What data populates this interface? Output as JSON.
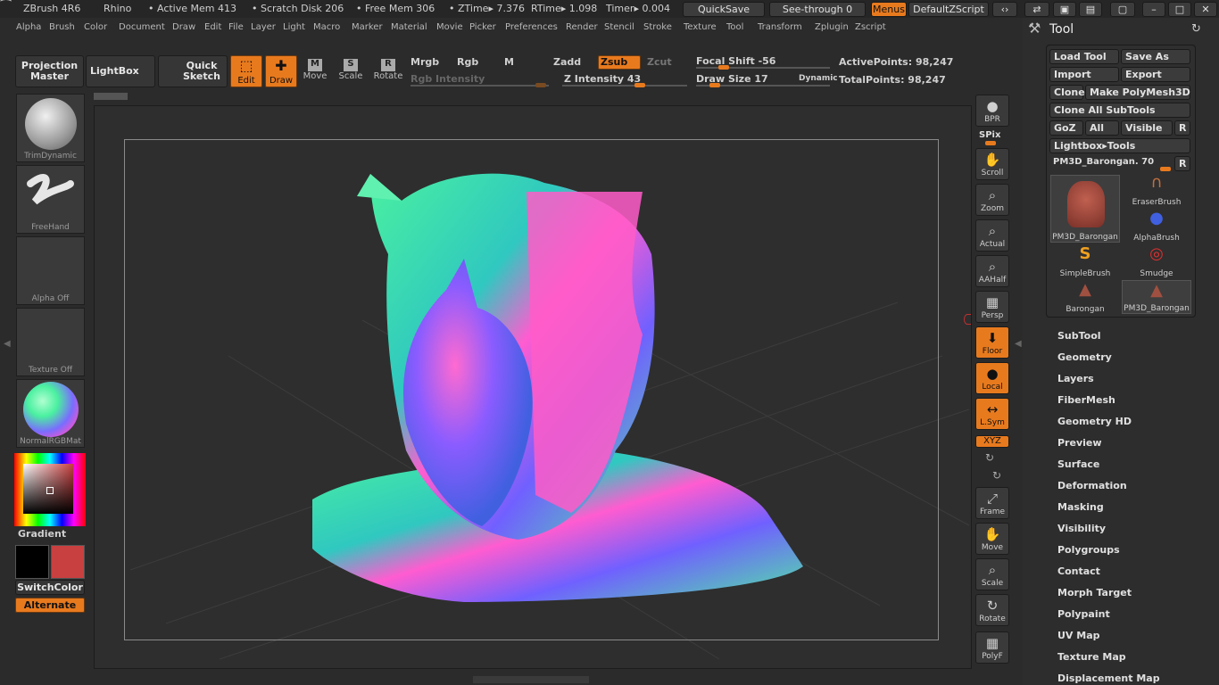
{
  "title_bar": {
    "app": "ZBrush 4R6",
    "doc": "Rhino",
    "active_mem": "• Active Mem 413",
    "scratch": "• Scratch Disk 206",
    "free_mem": "• Free Mem 306",
    "ztime": "• ZTime▸ 7.376",
    "rtime": "RTime▸ 1.098",
    "timer": "Timer▸ 0.004",
    "quicksave": "QuickSave",
    "seethrough": "See-through  0",
    "menus": "Menus",
    "script": "DefaultZScript"
  },
  "menu_items": [
    "Alpha",
    "Brush",
    "Color",
    "Document",
    "Draw",
    "Edit",
    "File",
    "Layer",
    "Light",
    "Macro",
    "Marker",
    "Material",
    "Movie",
    "Picker",
    "Preferences",
    "Render",
    "Stencil",
    "Stroke",
    "Texture",
    "Tool",
    "Transform",
    "Zplugin",
    "Zscript"
  ],
  "toolbar": {
    "projection": "Projection Master",
    "lightbox": "LightBox",
    "quick_sketch": "Quick Sketch",
    "edit": "Edit",
    "draw": "Draw",
    "move": "Move",
    "scale": "Scale",
    "rotate": "Rotate",
    "mrgb": "Mrgb",
    "rgb": "Rgb",
    "m": "M",
    "zadd": "Zadd",
    "zsub": "Zsub",
    "zcut": "Zcut",
    "rgb_intensity": "Rgb Intensity",
    "z_intensity": "Z Intensity 43",
    "focal_shift": "Focal Shift -56",
    "draw_size": "Draw Size 17",
    "dynamic": "Dynamic",
    "active_points": "ActivePoints: 98,247",
    "total_points": "TotalPoints: 98,247"
  },
  "left_shelf": {
    "brush": "TrimDynamic",
    "stroke": "FreeHand",
    "alpha": "Alpha Off",
    "texture": "Texture Off",
    "material": "NormalRGBMat",
    "gradient": "Gradient",
    "switch": "SwitchColor",
    "alternate": "Alternate"
  },
  "right_shelf": [
    {
      "label": "BPR"
    },
    {
      "label": "SPix"
    },
    {
      "label": "Scroll"
    },
    {
      "label": "Zoom"
    },
    {
      "label": "Actual"
    },
    {
      "label": "AAHalf"
    },
    {
      "label": "Persp"
    },
    {
      "label": "Floor"
    },
    {
      "label": "Local"
    },
    {
      "label": "L.Sym"
    },
    {
      "label": "XYZ"
    },
    {
      "label": "Frame"
    },
    {
      "label": "Move"
    },
    {
      "label": "Scale"
    },
    {
      "label": "Rotate"
    },
    {
      "label": "PolyF"
    }
  ],
  "tool_panel": {
    "title": "Tool",
    "load": "Load Tool",
    "save": "Save As",
    "import": "Import",
    "export": "Export",
    "clone": "Clone",
    "make": "Make PolyMesh3D",
    "clone_all": "Clone  All SubTools",
    "goz": "GoZ",
    "all": "All",
    "visible": "Visible",
    "r": "R",
    "lightbox_tools": "Lightbox▸Tools",
    "current": "PM3D_Barongan. 70",
    "tools": [
      "PM3D_Barongan",
      "EraserBrush",
      "AlphaBrush",
      "SimpleBrush",
      "Smudge",
      "Barongan",
      "PM3D_Barongan"
    ],
    "sections": [
      "SubTool",
      "Geometry",
      "Layers",
      "FiberMesh",
      "Geometry HD",
      "Preview",
      "Surface",
      "Deformation",
      "Masking",
      "Visibility",
      "Polygroups",
      "Contact",
      "Morph Target",
      "Polypaint",
      "UV Map",
      "Texture Map",
      "Displacement Map"
    ]
  },
  "colors": {
    "accent": "#e87a1e",
    "secondary": "#c94040",
    "primary": "#000000"
  }
}
